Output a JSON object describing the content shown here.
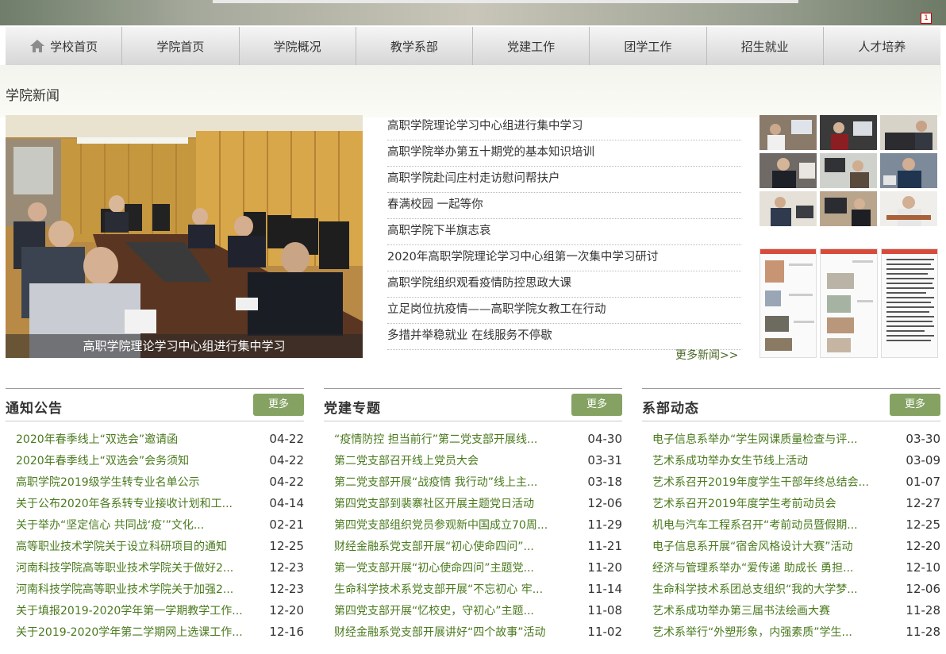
{
  "banner_badge": "1",
  "nav": [
    "学校首页",
    "学院首页",
    "学院概况",
    "教学系部",
    "党建工作",
    "团学工作",
    "招生就业",
    "人才培养"
  ],
  "section_title": "学院新闻",
  "photo_caption": "高职学院理论学习中心组进行集中学习",
  "news": [
    "高职学院理论学习中心组进行集中学习",
    "高职学院举办第五十期党的基本知识培训",
    "高职学院赴闫庄村走访慰问帮扶户",
    "春满校园 一起等你",
    "高职学院下半旗志哀",
    "2020年高职学院理论学习中心组第一次集中学习研讨",
    "高职学院组织观看疫情防控思政大课",
    "立足岗位抗疫情——高职学院女教工在行动",
    "多措并举稳就业 在线服务不停歇"
  ],
  "more_news": "更多新闻>>",
  "columns": [
    {
      "title": "通知公告",
      "more": "更多",
      "items": [
        {
          "t": "2020年春季线上“双选会”邀请函",
          "d": "04-22"
        },
        {
          "t": "2020年春季线上“双选会”会务须知",
          "d": "04-22"
        },
        {
          "t": "高职学院2019级学生转专业名单公示",
          "d": "04-22"
        },
        {
          "t": "关于公布2020年各系转专业接收计划和工...",
          "d": "04-14"
        },
        {
          "t": "关于举办“坚定信心 共同战‘疫’”文化...",
          "d": "02-21"
        },
        {
          "t": "高等职业技术学院关于设立科研项目的通知",
          "d": "12-25"
        },
        {
          "t": "河南科技学院高等职业技术学院关于做好2...",
          "d": "12-23"
        },
        {
          "t": "河南科技学院高等职业技术学院关于加强2...",
          "d": "12-23"
        },
        {
          "t": "关于填报2019-2020学年第一学期教学工作...",
          "d": "12-20"
        },
        {
          "t": "关于2019-2020学年第二学期网上选课工作...",
          "d": "12-16"
        }
      ]
    },
    {
      "title": "党建专题",
      "more": "更多",
      "items": [
        {
          "t": "“疫情防控 担当前行”第二党支部开展线...",
          "d": "04-30"
        },
        {
          "t": "第二党支部召开线上党员大会",
          "d": "03-31"
        },
        {
          "t": "第二党支部开展“战疫情 我行动”线上主...",
          "d": "03-18"
        },
        {
          "t": "第四党支部到裴寨社区开展主题党日活动",
          "d": "12-06"
        },
        {
          "t": "第四党支部组织党员参观新中国成立70周...",
          "d": "11-29"
        },
        {
          "t": "财经金融系党支部开展“初心使命四问”...",
          "d": "11-21"
        },
        {
          "t": "第一党支部开展“初心使命四问”主题党...",
          "d": "11-20"
        },
        {
          "t": "生命科学技术系党支部开展“不忘初心 牢...",
          "d": "11-14"
        },
        {
          "t": "第四党支部开展“忆校史，守初心”主题...",
          "d": "11-08"
        },
        {
          "t": "财经金融系党支部开展讲好“四个故事”活动",
          "d": "11-02"
        }
      ]
    },
    {
      "title": "系部动态",
      "more": "更多",
      "items": [
        {
          "t": "电子信息系举办“学生网课质量检查与评...",
          "d": "03-30"
        },
        {
          "t": "艺术系成功举办女生节线上活动",
          "d": "03-09"
        },
        {
          "t": "艺术系召开2019年度学生干部年终总结会...",
          "d": "01-07"
        },
        {
          "t": "艺术系召开2019年度学生考前动员会",
          "d": "12-27"
        },
        {
          "t": "机电与汽车工程系召开“考前动员暨假期...",
          "d": "12-25"
        },
        {
          "t": "电子信息系开展“宿舍风格设计大赛”活动",
          "d": "12-20"
        },
        {
          "t": "经济与管理系举办“爱传递 助成长 勇担...",
          "d": "12-10"
        },
        {
          "t": "生命科学技术系团总支组织“我的大学梦...",
          "d": "12-06"
        },
        {
          "t": "艺术系成功举办第三届书法绘画大赛",
          "d": "11-28"
        },
        {
          "t": "艺术系举行“外塑形象，内强素质”学生...",
          "d": "11-28"
        }
      ]
    }
  ]
}
